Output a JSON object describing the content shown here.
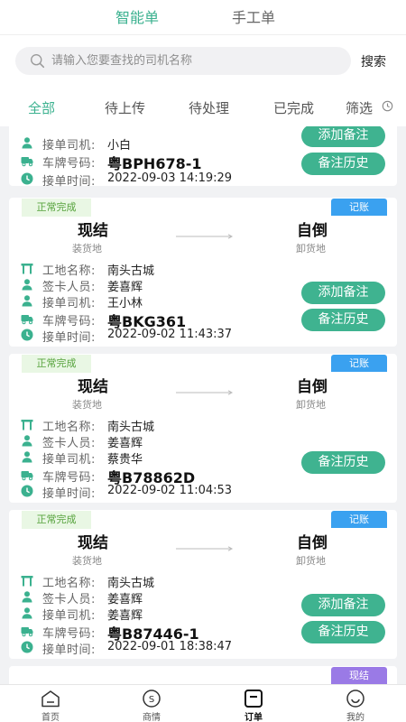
{
  "header": {
    "tabs": [
      {
        "label": "智能单",
        "active": true
      },
      {
        "label": "手工单",
        "active": false
      }
    ]
  },
  "search": {
    "placeholder": "请输入您要查找的司机名称",
    "button_label": "搜索"
  },
  "filters": {
    "tabs": [
      "全部",
      "待上传",
      "待处理",
      "已完成"
    ],
    "active_index": 0,
    "filter_label": "筛选"
  },
  "labels": {
    "site": "工地名称:",
    "signer": "签卡人员:",
    "driver": "接单司机:",
    "plate": "车牌号码:",
    "time": "接单时间:",
    "from_sub": "装货地",
    "to_sub": "卸货地",
    "add_note": "添加备注",
    "note_history": "备注历史"
  },
  "orders": [
    {
      "status": "",
      "type": "",
      "from": "",
      "to": "",
      "site": "",
      "signer": "",
      "driver": "小白",
      "plate": "粤BPH678-1",
      "time": "2022-09-03 14:19:29",
      "can_add_note": true
    },
    {
      "status": "正常完成",
      "type": "记账",
      "from": "现结",
      "to": "自倒",
      "site": "南头古城",
      "signer": "姜喜辉",
      "driver": "王小林",
      "plate": "粤BKG361",
      "time": "2022-09-02 11:43:37",
      "can_add_note": true
    },
    {
      "status": "正常完成",
      "type": "记账",
      "from": "现结",
      "to": "自倒",
      "site": "南头古城",
      "signer": "姜喜辉",
      "driver": "蔡贵华",
      "plate": "粤B78862D",
      "time": "2022-09-02 11:04:53",
      "can_add_note": false
    },
    {
      "status": "正常完成",
      "type": "记账",
      "from": "现结",
      "to": "自倒",
      "site": "南头古城",
      "signer": "姜喜辉",
      "driver": "姜喜辉",
      "plate": "粤B87446-1",
      "time": "2022-09-01 18:38:47",
      "can_add_note": true
    },
    {
      "status": "",
      "type": "现结"
    }
  ],
  "bottom_nav": [
    {
      "label": "首页",
      "icon": "home-icon",
      "active": false
    },
    {
      "label": "商情",
      "icon": "market-icon",
      "active": false
    },
    {
      "label": "订单",
      "icon": "order-icon",
      "active": true
    },
    {
      "label": "我的",
      "icon": "profile-icon",
      "active": false
    }
  ],
  "colors": {
    "accent": "#3bb18f",
    "button": "#3fb390",
    "badge_blue": "#3aa1f0",
    "badge_purple": "#9a7ae6",
    "status_bg": "#e9f7e4",
    "status_text": "#56a33c"
  }
}
